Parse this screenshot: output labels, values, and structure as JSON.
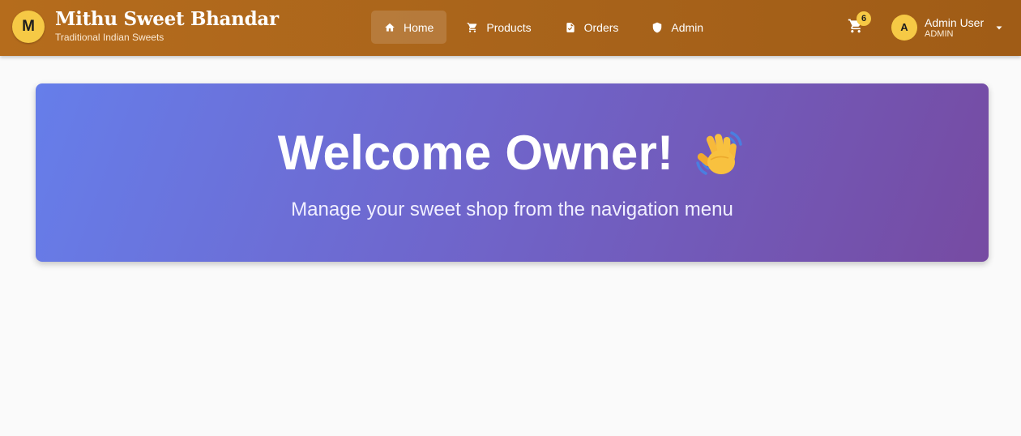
{
  "brand": {
    "logo_letter": "M",
    "title": "Mithu Sweet Bhandar",
    "subtitle": "Traditional Indian Sweets"
  },
  "nav": {
    "items": [
      {
        "label": "Home",
        "icon": "home-icon",
        "active": true
      },
      {
        "label": "Products",
        "icon": "cart-icon",
        "active": false
      },
      {
        "label": "Orders",
        "icon": "receipt-icon",
        "active": false
      },
      {
        "label": "Admin",
        "icon": "shield-icon",
        "active": false
      }
    ]
  },
  "cart": {
    "icon": "cart-icon",
    "count": "6"
  },
  "user": {
    "avatar_letter": "A",
    "name": "Admin User",
    "role": "ADMIN",
    "caret_icon": "caret-down-icon"
  },
  "hero": {
    "title": "Welcome Owner!",
    "emoji_icon": "waving-hand-icon",
    "subtitle": "Manage your sweet shop from the navigation menu"
  },
  "colors": {
    "appbar": "#a9641b",
    "accent_yellow": "#f6c945",
    "hero_gradient_start": "#667eea",
    "hero_gradient_end": "#764ba2",
    "page_background": "#fafafa"
  }
}
